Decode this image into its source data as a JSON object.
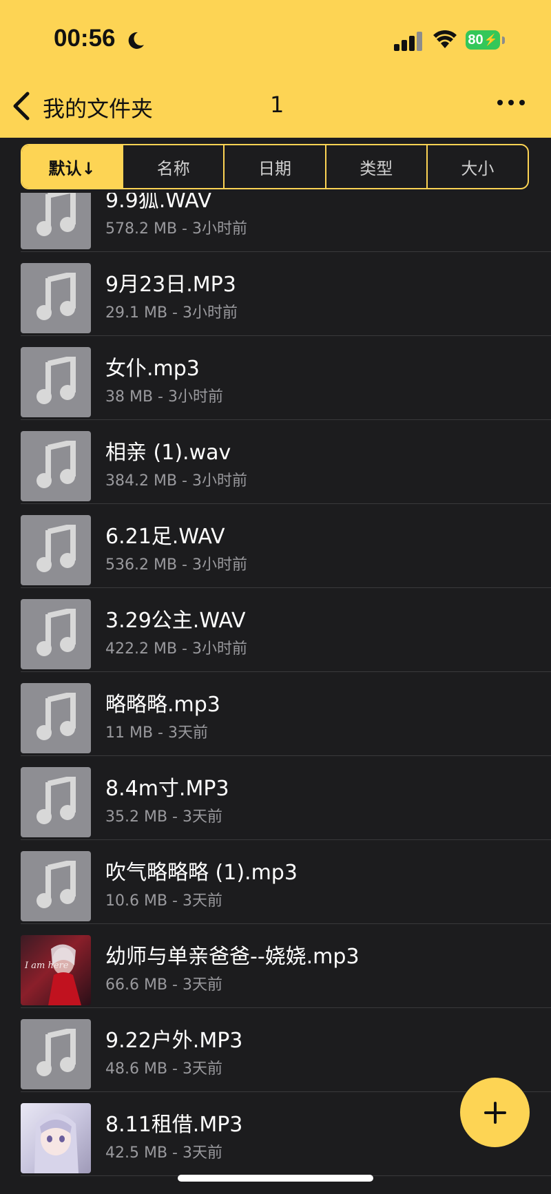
{
  "status": {
    "time": "00:56",
    "battery": "80"
  },
  "nav": {
    "title": "我的文件夹",
    "count": "1"
  },
  "sort": [
    "默认↓",
    "名称",
    "日期",
    "类型",
    "大小"
  ],
  "files": [
    {
      "name": "9.9狐.WAV",
      "meta": "578.2 MB - 3小时前",
      "thumb": "music-note"
    },
    {
      "name": "9月23日.MP3",
      "meta": "29.1 MB - 3小时前",
      "thumb": "music-note"
    },
    {
      "name": "女仆.mp3",
      "meta": "38 MB - 3小时前",
      "thumb": "music-note"
    },
    {
      "name": "相亲 (1).wav",
      "meta": "384.2 MB - 3小时前",
      "thumb": "music-note"
    },
    {
      "name": "6.21足.WAV",
      "meta": "536.2 MB - 3小时前",
      "thumb": "music-note"
    },
    {
      "name": "3.29公主.WAV",
      "meta": "422.2 MB - 3小时前",
      "thumb": "music-note"
    },
    {
      "name": "略略略.mp3",
      "meta": "11 MB - 3天前",
      "thumb": "music-note"
    },
    {
      "name": "8.4m寸.MP3",
      "meta": "35.2 MB - 3天前",
      "thumb": "music-note"
    },
    {
      "name": "吹气略略略 (1).mp3",
      "meta": "10.6 MB - 3天前",
      "thumb": "music-note"
    },
    {
      "name": "幼师与单亲爸爸--娆娆.mp3",
      "meta": "66.6 MB - 3天前",
      "thumb": "album-art"
    },
    {
      "name": "9.22户外.MP3",
      "meta": "48.6 MB - 3天前",
      "thumb": "music-note"
    },
    {
      "name": "8.11租借.MP3",
      "meta": "42.5 MB - 3天前",
      "thumb": "album-art"
    }
  ],
  "colors": {
    "accent": "#fdd454",
    "background": "#1c1c1e",
    "meta_text": "#9a9a9e"
  },
  "icons": [
    "back-chevron-icon",
    "more-icon",
    "music-note-icon",
    "add-icon"
  ]
}
